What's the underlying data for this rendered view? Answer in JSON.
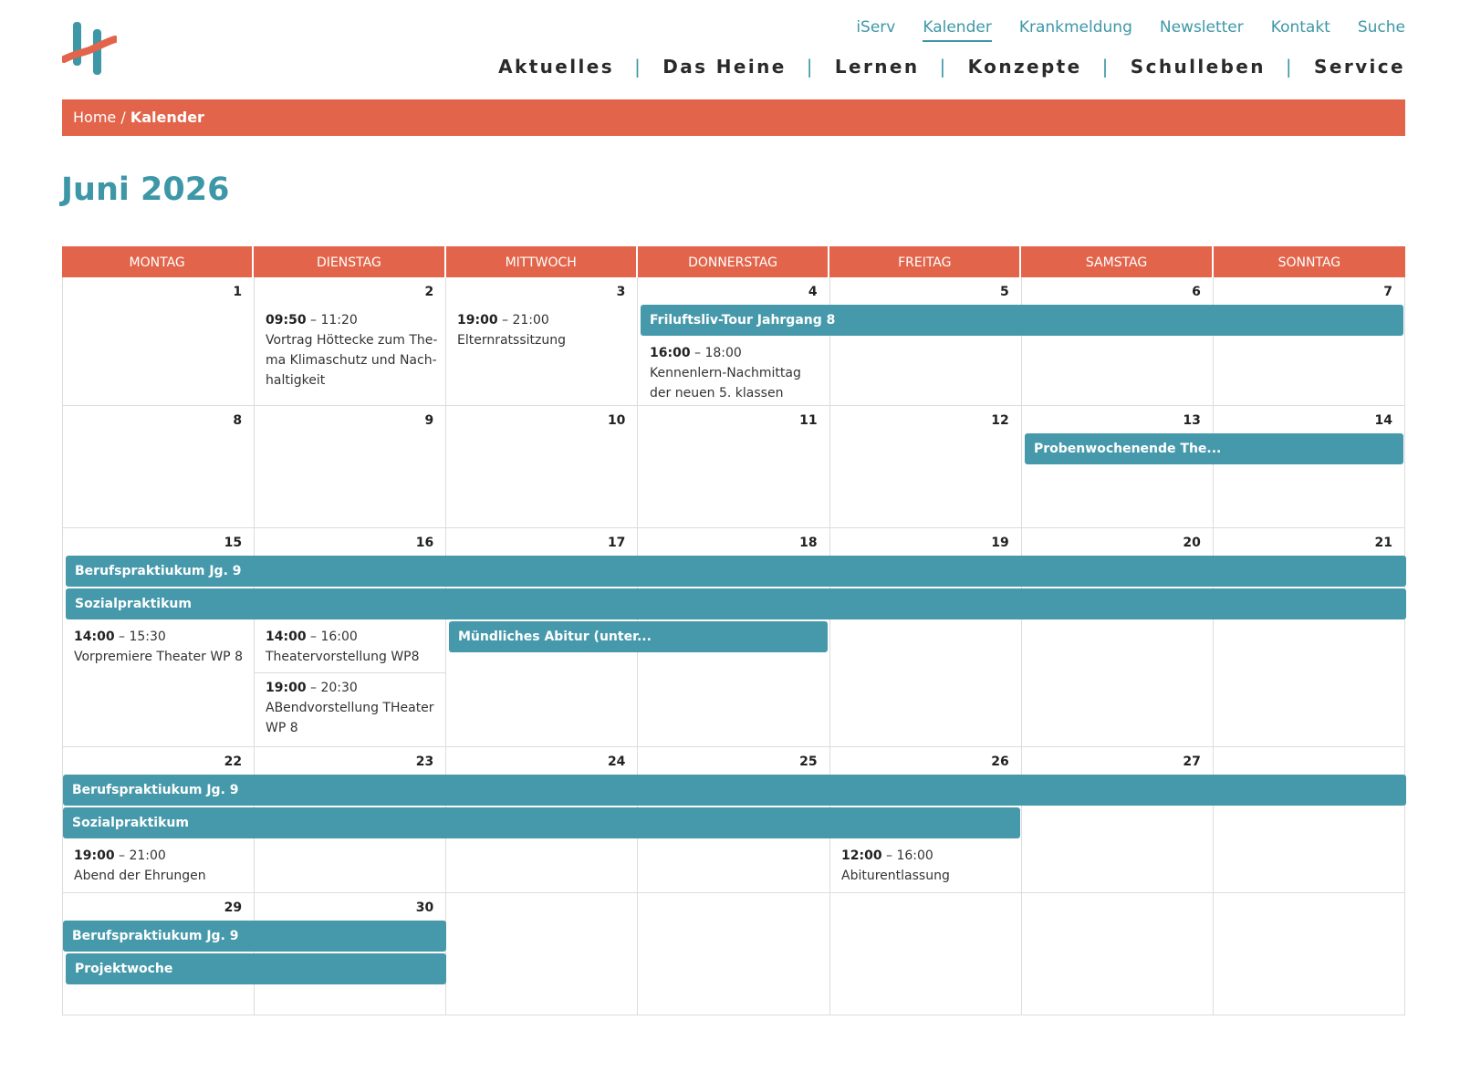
{
  "header": {
    "logo_icon": "school-h-logo",
    "top_links": [
      "iServ",
      "Kalender",
      "Krankmeldung",
      "Newsletter",
      "Kontakt",
      "Suche"
    ],
    "active_top_link": "Kalender",
    "main_nav": [
      "Aktuelles",
      "Das Heine",
      "Lernen",
      "Konzepte",
      "Schulleben",
      "Service"
    ],
    "nav_separator": "|"
  },
  "breadcrumb": {
    "home": "Home",
    "separator": " / ",
    "current": "Kalender"
  },
  "calendar": {
    "month_title": "Juni 2026",
    "weekdays": [
      "MONTAG",
      "DIENSTAG",
      "MITTWOCH",
      "DONNERSTAG",
      "FREITAG",
      "SAMSTAG",
      "SONNTAG"
    ],
    "weeks": [
      {
        "days": [
          "1",
          "2",
          "3",
          "4",
          "5",
          "6",
          "7"
        ],
        "bars": [
          "Friluftsliv-Tour Jahrgang 8"
        ],
        "events": [
          {
            "start": "09:50",
            "end": "11:20",
            "title": "Vortrag Höttecke zum The-\nma Klimaschutz und Nach-\nhaltigkeit"
          },
          {
            "start": "19:00",
            "end": "21:00",
            "title": "Elternratssitzung"
          },
          {
            "start": "16:00",
            "end": "18:00",
            "title": "Kennenlern-Nachmittag\nder neuen 5. klassen"
          }
        ]
      },
      {
        "days": [
          "8",
          "9",
          "10",
          "11",
          "12",
          "13",
          "14"
        ],
        "bars": [
          "Probenwochenende The..."
        ],
        "events": []
      },
      {
        "days": [
          "15",
          "16",
          "17",
          "18",
          "19",
          "20",
          "21"
        ],
        "bars": [
          "Berufspraktiukum Jg. 9",
          "Sozialpraktikum",
          "Mündliches Abitur (unter..."
        ],
        "events": [
          {
            "start": "14:00",
            "end": "15:30",
            "title": "Vorpremiere Theater WP 8"
          },
          {
            "start": "14:00",
            "end": "16:00",
            "title": "Theatervorstellung WP8"
          },
          {
            "start": "19:00",
            "end": "20:30",
            "title": "ABendvorstellung THeater\nWP 8"
          }
        ]
      },
      {
        "days": [
          "22",
          "23",
          "24",
          "25",
          "26",
          "27",
          ""
        ],
        "bars": [
          "Berufspraktiukum Jg. 9",
          "Sozialpraktikum"
        ],
        "events": [
          {
            "start": "19:00",
            "end": "21:00",
            "title": "Abend der Ehrungen"
          },
          {
            "start": "12:00",
            "end": "16:00",
            "title": "Abiturentlassung"
          }
        ]
      },
      {
        "days": [
          "29",
          "30",
          "",
          "",
          "",
          "",
          ""
        ],
        "bars": [
          "Berufspraktiukum Jg. 9",
          "Projektwoche"
        ],
        "events": []
      }
    ],
    "colors": {
      "accent": "#e2654b",
      "teal": "#3d97a7",
      "event_bar": "#4699ab",
      "grid": "#dcdcdc"
    }
  }
}
